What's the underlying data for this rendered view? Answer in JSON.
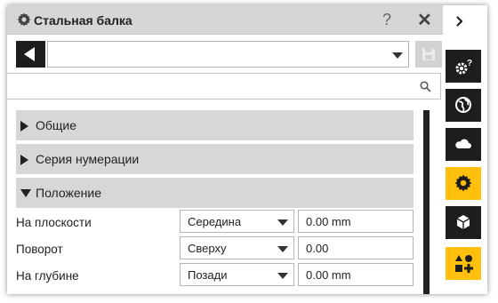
{
  "title": "Стальная балка",
  "help_label": "?",
  "close_label": "✕",
  "search": {
    "value": ""
  },
  "sections": [
    {
      "label": "Общие",
      "expanded": false
    },
    {
      "label": "Серия нумерации",
      "expanded": false
    },
    {
      "label": "Положение",
      "expanded": true
    }
  ],
  "rows": [
    {
      "label": "На плоскости",
      "option": "Середина",
      "value": "0.00 mm"
    },
    {
      "label": "Поворот",
      "option": "Сверху",
      "value": "0.00"
    },
    {
      "label": "На глубине",
      "option": "Позади",
      "value": "0.00 mm"
    }
  ],
  "sidebar": {
    "items": [
      {
        "icon": "chevron-right-icon"
      },
      {
        "icon": "gear-help-icon"
      },
      {
        "icon": "globe-icon"
      },
      {
        "icon": "cloud-icon"
      },
      {
        "icon": "gear-icon",
        "active": true
      },
      {
        "icon": "cube-icon"
      },
      {
        "icon": "shapes-add-icon"
      }
    ]
  },
  "colors": {
    "accent": "#ffbf0f",
    "dark": "#1d1d1d",
    "section_bg": "#d7d7d7",
    "titlebar_bg": "#d6d6d6"
  }
}
